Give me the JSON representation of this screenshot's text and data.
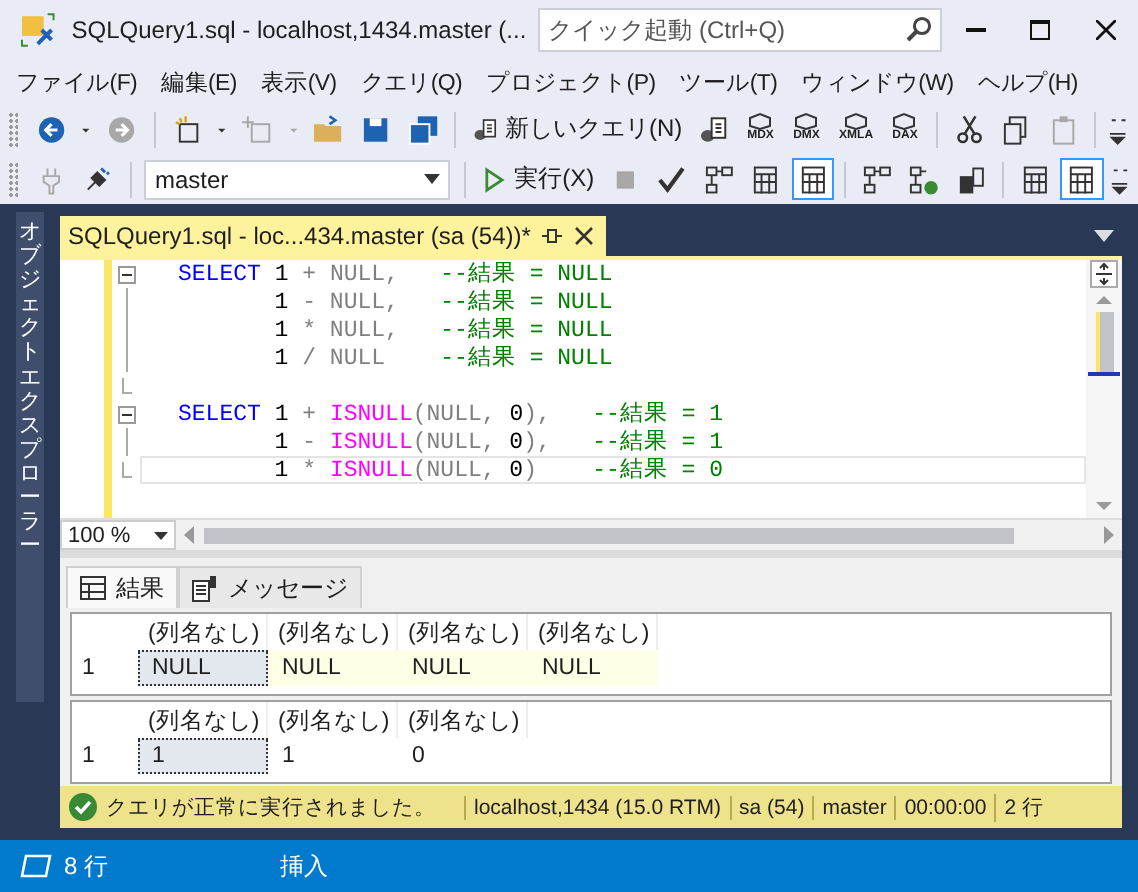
{
  "window": {
    "title": "SQLQuery1.sql - localhost,1434.master (...",
    "search_placeholder": "クイック起動 (Ctrl+Q)"
  },
  "menu": [
    "ファイル(F)",
    "編集(E)",
    "表示(V)",
    "クエリ(Q)",
    "プロジェクト(P)",
    "ツール(T)",
    "ウィンドウ(W)",
    "ヘルプ(H)"
  ],
  "toolbar_1": [
    {
      "kind": "back",
      "disabled": false
    },
    {
      "kind": "dropdown",
      "disabled": false
    },
    {
      "kind": "forward",
      "disabled": true
    },
    {
      "kind": "separator"
    },
    {
      "kind": "newproject",
      "disabled": false
    },
    {
      "kind": "dropdown",
      "disabled": false
    },
    {
      "kind": "additem",
      "disabled": true
    },
    {
      "kind": "dropdown",
      "disabled": true
    },
    {
      "kind": "open",
      "disabled": false
    },
    {
      "kind": "save",
      "disabled": false
    },
    {
      "kind": "saveall",
      "disabled": false
    },
    {
      "kind": "separator"
    },
    {
      "kind": "newquery",
      "label": "新しいクエリ(N)",
      "disabled": false
    },
    {
      "kind": "dbquery",
      "disabled": false
    },
    {
      "kind": "cubequery",
      "label": "MDX",
      "disabled": false
    },
    {
      "kind": "cubequery",
      "label": "DMX",
      "disabled": false
    },
    {
      "kind": "cubequery",
      "label": "XMLA",
      "disabled": false
    },
    {
      "kind": "cubequery",
      "label": "DAX",
      "disabled": false
    },
    {
      "kind": "separator"
    },
    {
      "kind": "cut",
      "disabled": false
    },
    {
      "kind": "copy",
      "disabled": false
    },
    {
      "kind": "paste",
      "disabled": true
    },
    {
      "kind": "separator"
    },
    {
      "kind": "overflow"
    }
  ],
  "toolbar_2": [
    {
      "kind": "plug",
      "disabled": true
    },
    {
      "kind": "connect",
      "disabled": false
    },
    {
      "kind": "separator"
    },
    {
      "kind": "database",
      "value": "master"
    },
    {
      "kind": "separator"
    },
    {
      "kind": "execute",
      "label": "実行(X)",
      "disabled": false
    },
    {
      "kind": "stop",
      "disabled": true
    },
    {
      "kind": "parse",
      "disabled": false
    },
    {
      "kind": "plan",
      "disabled": false
    },
    {
      "kind": "toggle",
      "selected": false
    },
    {
      "kind": "toggle",
      "selected": true
    },
    {
      "kind": "separator"
    },
    {
      "kind": "plan",
      "disabled": false
    },
    {
      "kind": "planok",
      "disabled": false
    },
    {
      "kind": "stats",
      "disabled": false
    },
    {
      "kind": "separator"
    },
    {
      "kind": "toggle",
      "selected": false
    },
    {
      "kind": "toggle",
      "selected": true
    },
    {
      "kind": "overflow"
    }
  ],
  "sidebar": {
    "label": "オブジェクトエクスプローラー"
  },
  "document_tab": {
    "title": "SQLQuery1.sql - loc...434.master (sa (54))*",
    "selected": true
  },
  "code_lines": [
    {
      "fold_start": true,
      "current": false,
      "segments": [
        {
          "kind": "keyword",
          "text": "SELECT"
        },
        {
          "kind": "plain",
          "text": " 1 "
        },
        {
          "kind": "gray",
          "text": "+ NULL,"
        },
        {
          "kind": "comment",
          "text": "   --結果 = NULL"
        }
      ]
    },
    {
      "fold_start": false,
      "current": false,
      "segments": [
        {
          "kind": "plain",
          "text": "       1 "
        },
        {
          "kind": "gray",
          "text": "- NULL,"
        },
        {
          "kind": "comment",
          "text": "   --結果 = NULL"
        }
      ]
    },
    {
      "fold_start": false,
      "current": false,
      "segments": [
        {
          "kind": "plain",
          "text": "       1 "
        },
        {
          "kind": "gray",
          "text": "* NULL,"
        },
        {
          "kind": "comment",
          "text": "   --結果 = NULL"
        }
      ]
    },
    {
      "fold_start": false,
      "current": false,
      "segments": [
        {
          "kind": "plain",
          "text": "       1 "
        },
        {
          "kind": "gray",
          "text": "/ NULL"
        },
        {
          "kind": "comment",
          "text": "    --結果 = NULL"
        }
      ]
    },
    {
      "fold_start": false,
      "current": false
    },
    {
      "fold_start": true,
      "current": false,
      "segments": [
        {
          "kind": "keyword",
          "text": "SELECT"
        },
        {
          "kind": "plain",
          "text": " 1 "
        },
        {
          "kind": "gray",
          "text": "+ "
        },
        {
          "kind": "function",
          "text": "ISNULL"
        },
        {
          "kind": "gray",
          "text": "(NULL, "
        },
        {
          "kind": "plain",
          "text": "0"
        },
        {
          "kind": "gray",
          "text": "),"
        },
        {
          "kind": "comment",
          "text": "   --結果 = 1"
        }
      ]
    },
    {
      "fold_start": false,
      "current": false,
      "segments": [
        {
          "kind": "plain",
          "text": "       1 "
        },
        {
          "kind": "gray",
          "text": "- "
        },
        {
          "kind": "function",
          "text": "ISNULL"
        },
        {
          "kind": "gray",
          "text": "(NULL, "
        },
        {
          "kind": "plain",
          "text": "0"
        },
        {
          "kind": "gray",
          "text": "),"
        },
        {
          "kind": "comment",
          "text": "   --結果 = 1"
        }
      ]
    },
    {
      "fold_start": false,
      "current": true,
      "segments": [
        {
          "kind": "plain",
          "text": "       1 "
        },
        {
          "kind": "gray",
          "text": "* "
        },
        {
          "kind": "function",
          "text": "ISNULL"
        },
        {
          "kind": "gray",
          "text": "(NULL, "
        },
        {
          "kind": "plain",
          "text": "0"
        },
        {
          "kind": "gray",
          "text": ")"
        },
        {
          "kind": "comment",
          "text": "    --結果 = 0"
        }
      ]
    }
  ],
  "zoom": "100 %",
  "result_tabs": [
    {
      "kind": "grid",
      "label": "結果",
      "selected": true
    },
    {
      "kind": "messages",
      "label": "メッセージ",
      "selected": false
    }
  ],
  "results": [
    {
      "columns": [
        "(列名なし)",
        "(列名なし)",
        "(列名なし)",
        "(列名なし)"
      ],
      "rows": [
        {
          "number": "1",
          "cells": [
            {
              "text": "NULL",
              "is_null": true,
              "selected": true
            },
            {
              "text": "NULL",
              "is_null": true,
              "selected": false
            },
            {
              "text": "NULL",
              "is_null": true,
              "selected": false
            },
            {
              "text": "NULL",
              "is_null": true,
              "selected": false
            }
          ]
        }
      ]
    },
    {
      "columns": [
        "(列名なし)",
        "(列名なし)",
        "(列名なし)"
      ],
      "rows": [
        {
          "number": "1",
          "cells": [
            {
              "text": "1",
              "is_null": false,
              "selected": true
            },
            {
              "text": "1",
              "is_null": false,
              "selected": false
            },
            {
              "text": "0",
              "is_null": false,
              "selected": false
            }
          ]
        }
      ]
    }
  ],
  "query_status": {
    "message": "クエリが正常に実行されました。",
    "server": "localhost,1434 (15.0 RTM)",
    "user": "sa (54)",
    "database": "master",
    "elapsed": "00:00:00",
    "rows": "2 行"
  },
  "status_bar": {
    "line": "8 行",
    "mode": "挿入"
  }
}
